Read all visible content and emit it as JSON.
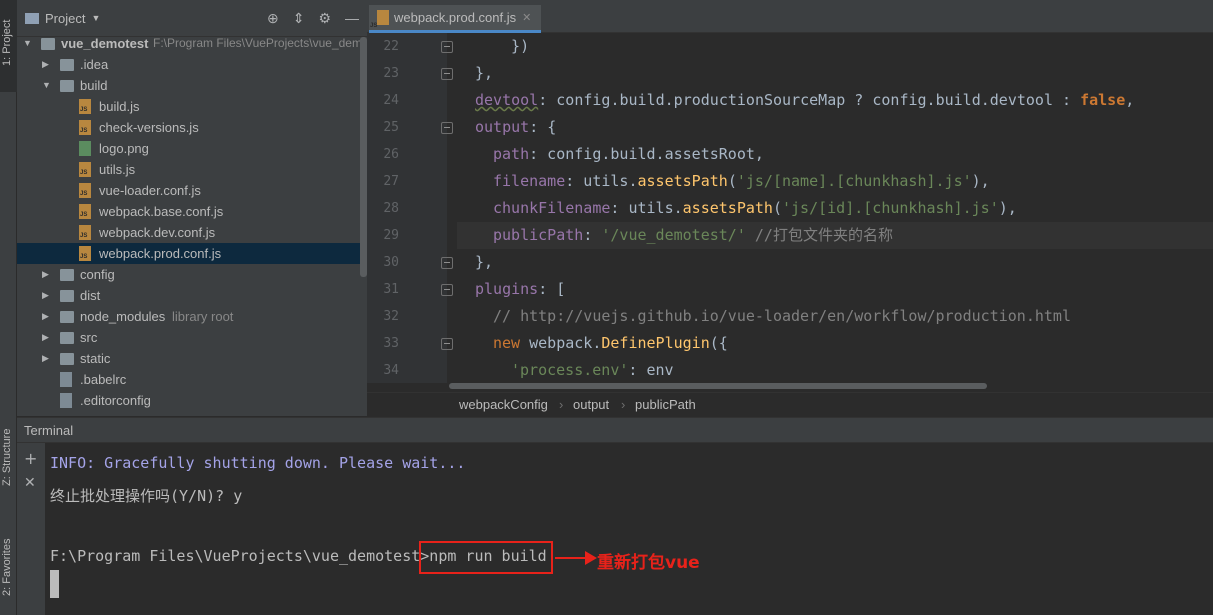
{
  "side_tabs": {
    "project": "1: Project",
    "structure": "Z: Structure",
    "favorites": "2: Favorites"
  },
  "project_panel": {
    "title": "Project",
    "tree": [
      {
        "label": "vue_demotest",
        "extra": "F:\\Program Files\\VueProjects\\vue_dem",
        "type": "folder",
        "depth": 0,
        "expanded": true
      },
      {
        "label": ".idea",
        "type": "folder",
        "depth": 1,
        "expanded": false
      },
      {
        "label": "build",
        "type": "folder",
        "depth": 1,
        "expanded": true
      },
      {
        "label": "build.js",
        "type": "js",
        "depth": 2
      },
      {
        "label": "check-versions.js",
        "type": "js",
        "depth": 2
      },
      {
        "label": "logo.png",
        "type": "png",
        "depth": 2
      },
      {
        "label": "utils.js",
        "type": "js",
        "depth": 2
      },
      {
        "label": "vue-loader.conf.js",
        "type": "js",
        "depth": 2
      },
      {
        "label": "webpack.base.conf.js",
        "type": "js",
        "depth": 2
      },
      {
        "label": "webpack.dev.conf.js",
        "type": "js",
        "depth": 2
      },
      {
        "label": "webpack.prod.conf.js",
        "type": "js",
        "depth": 2,
        "selected": true
      },
      {
        "label": "config",
        "type": "folder",
        "depth": 1,
        "expanded": false
      },
      {
        "label": "dist",
        "type": "folder",
        "depth": 1,
        "expanded": false
      },
      {
        "label": "node_modules",
        "extra": "library root",
        "type": "folder",
        "depth": 1,
        "expanded": false
      },
      {
        "label": "src",
        "type": "folder",
        "depth": 1,
        "expanded": false
      },
      {
        "label": "static",
        "type": "folder",
        "depth": 1,
        "expanded": false
      },
      {
        "label": ".babelrc",
        "type": "cfg",
        "depth": 1
      },
      {
        "label": ".editorconfig",
        "type": "cfg",
        "depth": 1
      }
    ]
  },
  "editor": {
    "tab": "webpack.prod.conf.js",
    "line_numbers": [
      "22",
      "23",
      "24",
      "25",
      "26",
      "27",
      "28",
      "29",
      "30",
      "31",
      "32",
      "33",
      "34"
    ],
    "code": {
      "l22": "  })",
      "l23": "},",
      "l24_prop": "devtool",
      "l24_a": ": config.build.productionSourceMap ? config.build.devtool : ",
      "l24_kw": "false",
      "l24_b": ",",
      "l25_prop": "output",
      "l25_a": ": {",
      "l26_prop": "path",
      "l26_a": ": config.build.assetsRoot,",
      "l27_prop": "filename",
      "l27_a": ": utils.",
      "l27_fn": "assetsPath",
      "l27_b": "(",
      "l27_str": "'js/[name].[chunkhash].js'",
      "l27_c": "),",
      "l28_prop": "chunkFilename",
      "l28_a": ": utils.",
      "l28_fn": "assetsPath",
      "l28_b": "(",
      "l28_str": "'js/[id].[chunkhash].js'",
      "l28_c": "),",
      "l29_prop": "publicPath",
      "l29_a": ": ",
      "l29_str": "'/vue_demotest/'",
      "l29_cmt": " //打包文件夹的名称",
      "l30": "},",
      "l31_prop": "plugins",
      "l31_a": ": [",
      "l32_cmt": "// http://vuejs.github.io/vue-loader/en/workflow/production.html",
      "l33_kw": "new",
      "l33_a": " webpack.",
      "l33_fn": "DefinePlugin",
      "l33_b": "({",
      "l34_str": "'process.env'",
      "l34_a": ": env"
    },
    "breadcrumb": [
      "webpackConfig",
      "output",
      "publicPath"
    ]
  },
  "terminal": {
    "title": "Terminal",
    "lines": {
      "info_prefix": "INFO:",
      "info_text": " Gracefully shutting down. Please wait...",
      "prompt_question": "终止批处理操作吗(Y/N)? y",
      "path_prompt": "F:\\Program Files\\VueProjects\\vue_demotest>",
      "command": "npm run build"
    },
    "annotation": "重新打包vue"
  }
}
